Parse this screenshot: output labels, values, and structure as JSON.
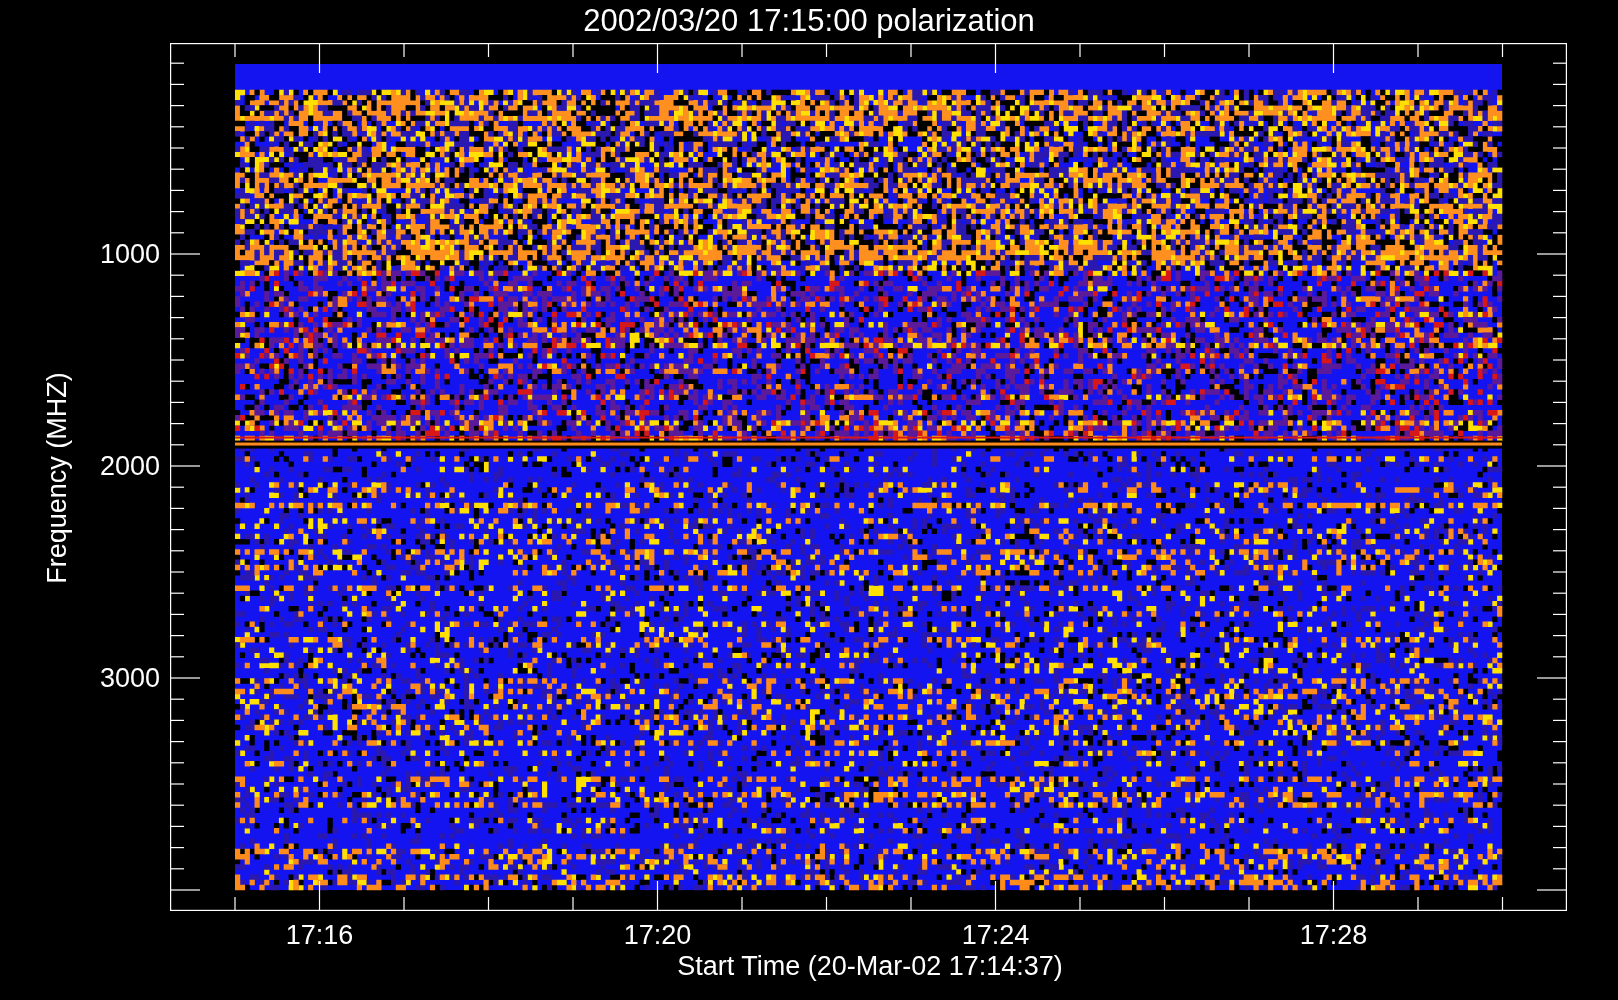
{
  "title": "2002/03/20 17:15:00 polarization",
  "xlabel": "Start Time (20-Mar-02 17:14:37)",
  "ylabel": "Frequency (MHZ)",
  "xticks": [
    "17:16",
    "17:20",
    "17:24",
    "17:28"
  ],
  "yticks": [
    "1000",
    "2000",
    "3000"
  ]
}
